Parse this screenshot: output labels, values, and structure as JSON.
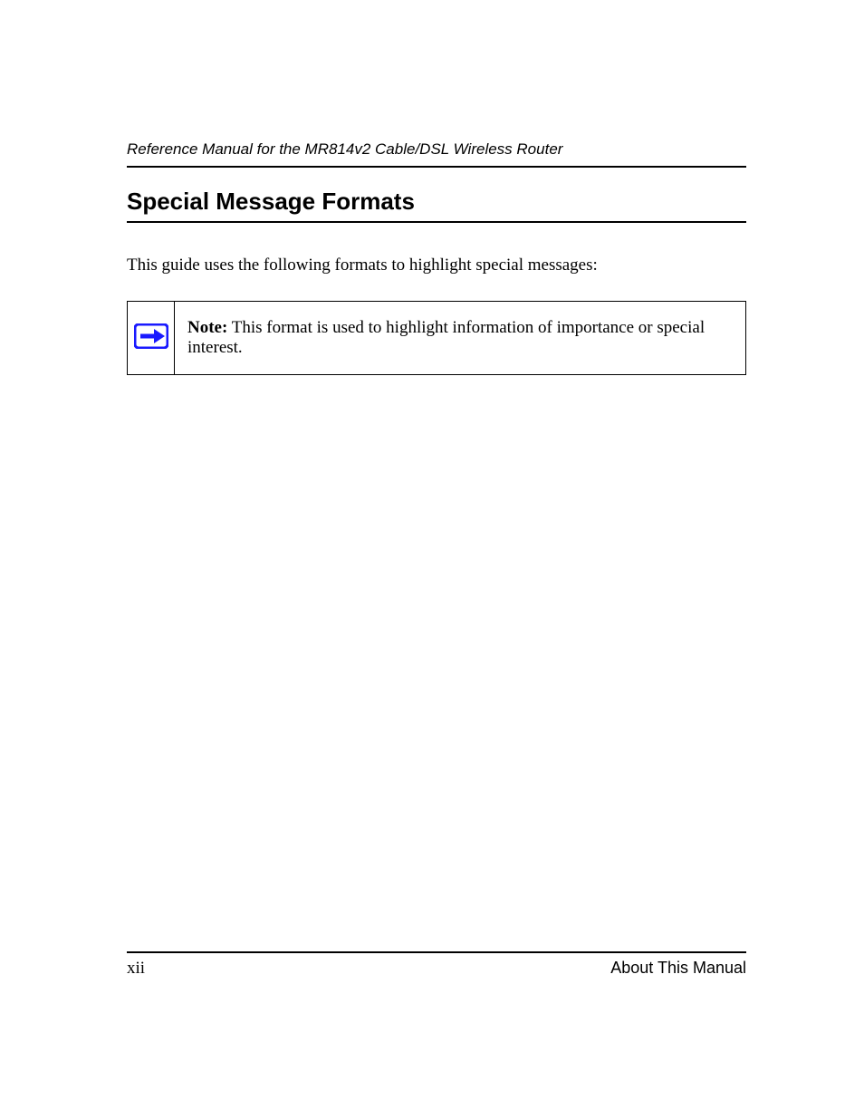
{
  "header": {
    "running_title": "Reference Manual for the MR814v2 Cable/DSL Wireless Router"
  },
  "section": {
    "title": "Special Message Formats",
    "intro": "This guide uses the following formats to highlight special messages:"
  },
  "note": {
    "label": "Note:",
    "text": " This format is used to highlight information of importance or special interest.",
    "icon_name": "arrow-right-icon",
    "icon_color": "#1a1aff"
  },
  "footer": {
    "page_number": "xii",
    "section_name": "About This Manual"
  }
}
